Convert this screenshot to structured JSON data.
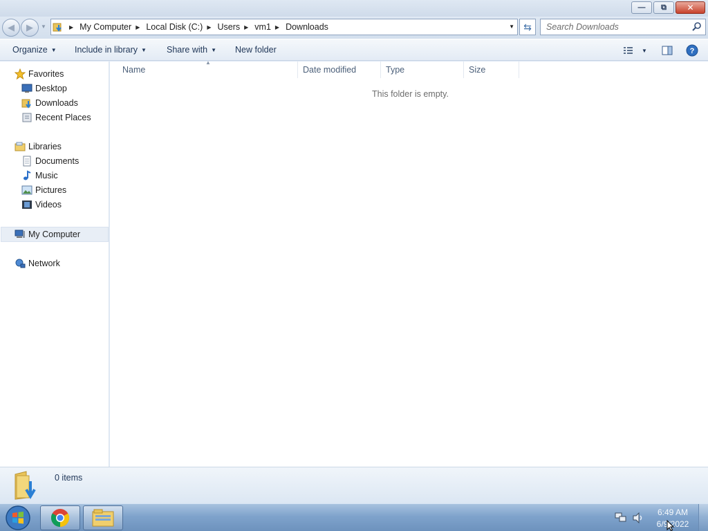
{
  "window": {
    "controls": {
      "minimize_icon": "minimize-icon",
      "restore_icon": "restore-icon",
      "close_icon": "close-icon"
    }
  },
  "navigation": {
    "breadcrumbs": [
      "My Computer",
      "Local Disk (C:)",
      "Users",
      "vm1",
      "Downloads"
    ],
    "search_placeholder": "Search Downloads"
  },
  "toolbar": {
    "organize": "Organize",
    "include_in_library": "Include in library",
    "share_with": "Share with",
    "new_folder": "New folder"
  },
  "sidebar": {
    "favorites": {
      "label": "Favorites",
      "items": [
        "Desktop",
        "Downloads",
        "Recent Places"
      ]
    },
    "libraries": {
      "label": "Libraries",
      "items": [
        "Documents",
        "Music",
        "Pictures",
        "Videos"
      ]
    },
    "computer": "My Computer",
    "network": "Network"
  },
  "columns": [
    "Name",
    "Date modified",
    "Type",
    "Size"
  ],
  "content": {
    "empty_message": "This folder is empty."
  },
  "details": {
    "item_count": "0 items"
  },
  "taskbar": {
    "time": "6:49 AM",
    "date": "6/9/2022"
  },
  "colors": {
    "accent": "#1e3557",
    "selection": "#e8eef6",
    "taskbar": "#7fa3cc"
  }
}
